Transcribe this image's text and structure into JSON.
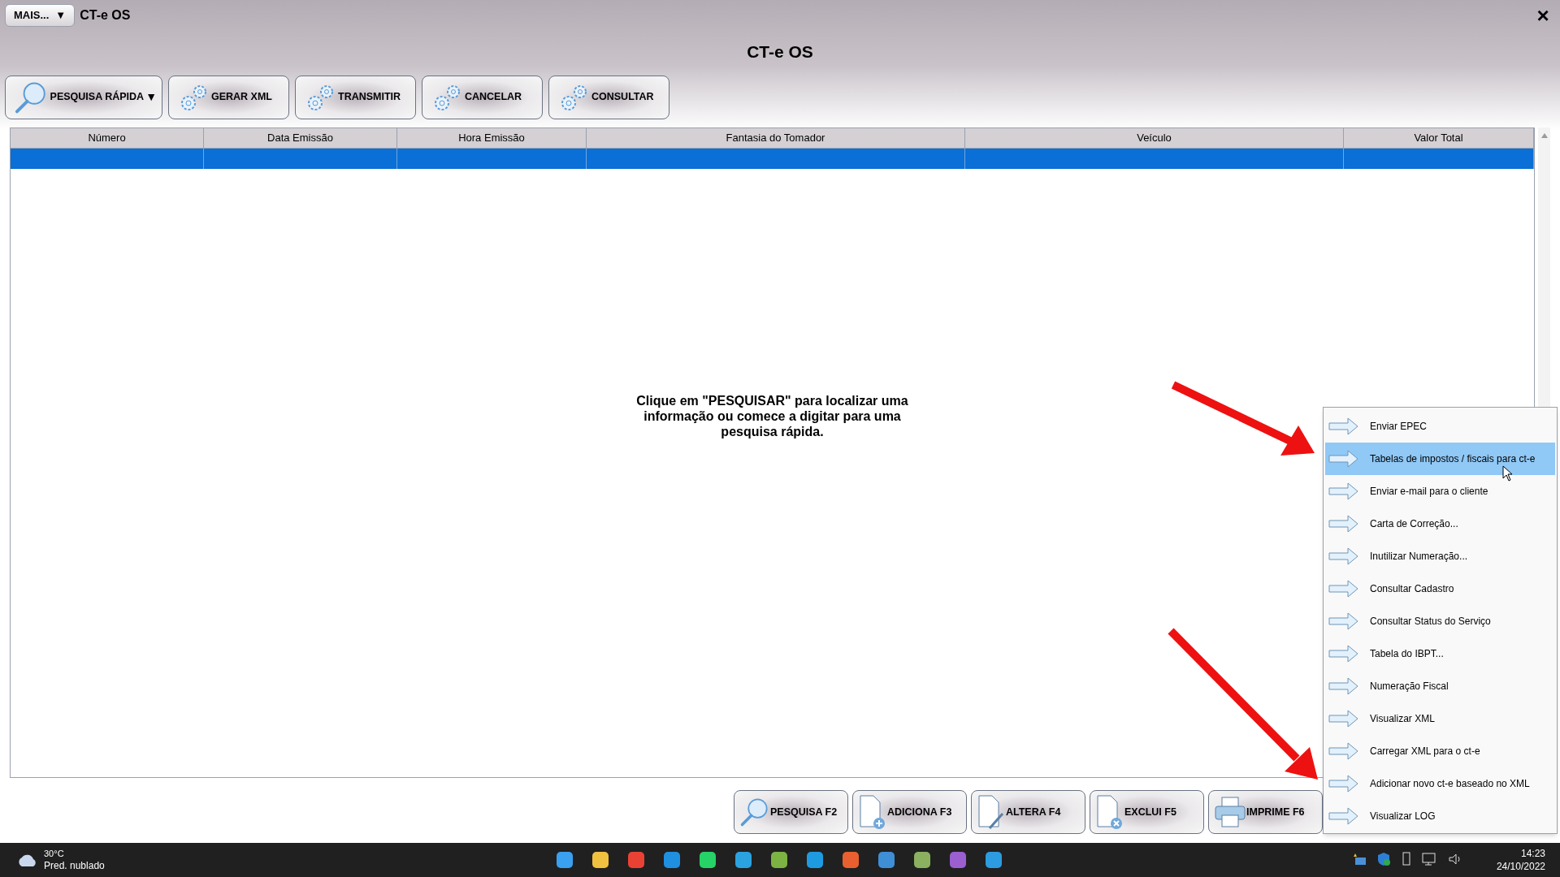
{
  "window": {
    "menu_button": "MAIS...",
    "menu_caret": "▼",
    "title": "CT-e OS",
    "close": "×",
    "heading": "CT-e OS"
  },
  "toolbar": [
    {
      "label": "PESQUISA RÁPIDA",
      "kind": "search",
      "caret": "▼"
    },
    {
      "label": "GERAR XML",
      "kind": "gears"
    },
    {
      "label": "TRANSMITIR",
      "kind": "gears"
    },
    {
      "label": "CANCELAR",
      "kind": "gears"
    },
    {
      "label": "CONSULTAR",
      "kind": "gears"
    }
  ],
  "table": {
    "columns": [
      "Número",
      "Data Emissão",
      "Hora Emissão",
      "Fantasia do Tomador",
      "Veículo",
      "Valor Total"
    ],
    "rows": [
      {
        "selected": true
      }
    ]
  },
  "message": "Clique em \"PESQUISAR\" para localizar uma informação ou comece a digitar para uma pesquisa rápida.",
  "context_menu": [
    {
      "label": "Enviar EPEC",
      "selected": false
    },
    {
      "label": "Tabelas de impostos / fiscais para ct-e",
      "selected": true
    },
    {
      "label": "Enviar e-mail para o cliente",
      "selected": false
    },
    {
      "label": "Carta de Correção...",
      "selected": false
    },
    {
      "label": "Inutilizar Numeração...",
      "selected": false
    },
    {
      "label": "Consultar Cadastro",
      "selected": false
    },
    {
      "label": "Consultar Status do Serviço",
      "selected": false
    },
    {
      "label": "Tabela do IBPT...",
      "selected": false
    },
    {
      "label": "Numeração Fiscal",
      "selected": false
    },
    {
      "label": "Visualizar XML",
      "selected": false
    },
    {
      "label": "Carregar XML para o ct-e",
      "selected": false
    },
    {
      "label": "Adicionar novo ct-e baseado no XML",
      "selected": false
    },
    {
      "label": "Visualizar LOG",
      "selected": false
    }
  ],
  "bottom_buttons": [
    {
      "label": "PESQUISA F2",
      "kind": "search"
    },
    {
      "label": "ADICIONA F3",
      "kind": "add"
    },
    {
      "label": "ALTERA F4",
      "kind": "edit"
    },
    {
      "label": "EXCLUI F5",
      "kind": "delete"
    },
    {
      "label": "IMPRIME F6",
      "kind": "print"
    }
  ],
  "taskbar": {
    "temperature": "30°C",
    "weather": "Pred. nublado",
    "time": "14:23",
    "date": "24/10/2022"
  }
}
